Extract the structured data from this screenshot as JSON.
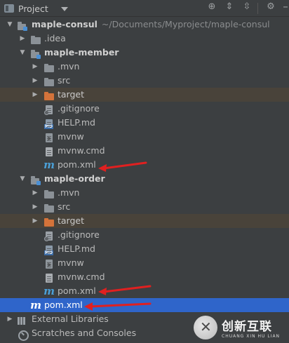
{
  "toolbar": {
    "title": "Project",
    "icons": [
      "project-view-icon",
      "dropdown-caret-icon",
      "locate-icon",
      "expand-all-icon",
      "collapse-all-icon",
      "settings-gear-icon",
      "hide-panel-icon"
    ]
  },
  "tree": {
    "root": {
      "name": "maple-consul",
      "path": "~/Documents/Myproject/maple-consul"
    },
    "root_children": [
      {
        "name": ".idea"
      }
    ],
    "modules": [
      {
        "name": "maple-member",
        "folders": [
          ".mvn",
          "src"
        ],
        "excluded": "target",
        "files": [
          ".gitignore",
          "HELP.md",
          "mvnw",
          "mvnw.cmd",
          "pom.xml"
        ]
      },
      {
        "name": "maple-order",
        "folders": [
          ".mvn",
          "src"
        ],
        "excluded": "target",
        "files": [
          ".gitignore",
          "HELP.md",
          "mvnw",
          "mvnw.cmd",
          "pom.xml"
        ]
      }
    ],
    "root_file": "pom.xml",
    "external_libraries": "External Libraries",
    "scratches": "Scratches and Consoles"
  },
  "colors": {
    "background": "#3c3f41",
    "selected": "#2f65ca",
    "excluded": "#49433a",
    "annotation_arrow": "#e02020",
    "maven_icon": "#4b9fd6"
  },
  "watermark": {
    "cn": "创新互联",
    "en": "CHUANG XIN HU LIAN"
  }
}
